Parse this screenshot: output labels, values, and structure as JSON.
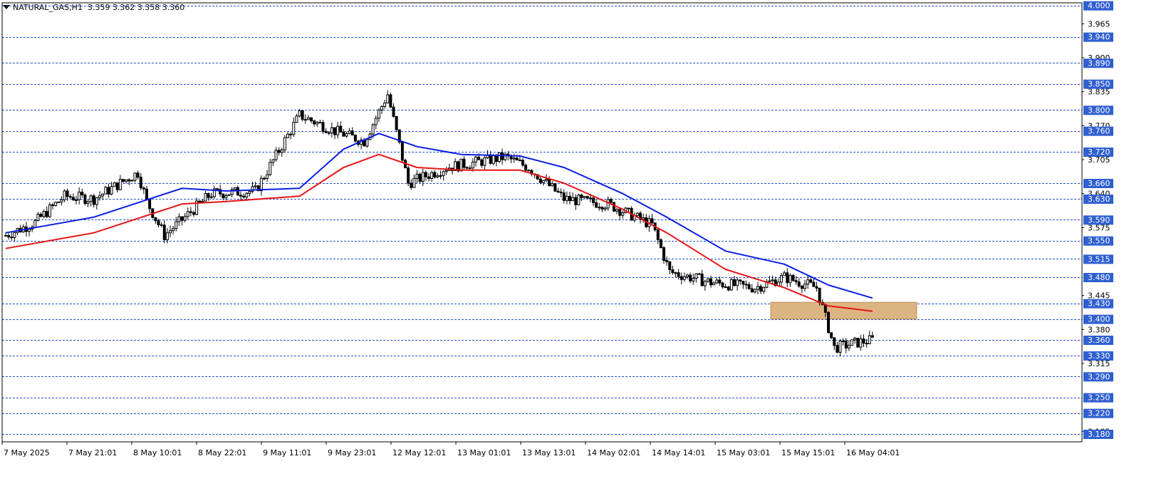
{
  "header": {
    "symbol": "NATURAL_GAS,H1",
    "ohlc": "3.359 3.362 3.358 3.360"
  },
  "colors": {
    "blue_line": "#0a1ee6",
    "red_line": "#e61414",
    "level_line": "#2850c8",
    "badge": "#2f5fd0",
    "zone": "#dcb482",
    "candle": "#000000"
  },
  "chart_data": {
    "type": "candlestick",
    "y_axis": {
      "min": 3.165,
      "max": 4.005,
      "ticks": [
        "3.965",
        "3.900",
        "3.835",
        "3.770",
        "3.705",
        "3.640",
        "3.575",
        "3.445",
        "3.380",
        "3.315",
        "3.185"
      ]
    },
    "levels": [
      "4.000",
      "3.940",
      "3.890",
      "3.850",
      "3.800",
      "3.760",
      "3.720",
      "3.660",
      "3.630",
      "3.590",
      "3.550",
      "3.515",
      "3.480",
      "3.430",
      "3.400",
      "3.360",
      "3.330",
      "3.290",
      "3.250",
      "3.220",
      "3.180"
    ],
    "zone": {
      "low": 3.4,
      "high": 3.432
    },
    "x_labels": [
      "7 May 2025",
      "7 May 21:01",
      "8 May 10:01",
      "8 May 22:01",
      "9 May 11:01",
      "9 May 23:01",
      "12 May 12:01",
      "13 May 01:01",
      "13 May 13:01",
      "14 May 02:01",
      "14 May 14:01",
      "15 May 03:01",
      "15 May 15:01",
      "16 May 04:01"
    ],
    "close_anchors": [
      [
        0,
        3.56
      ],
      [
        10,
        3.585
      ],
      [
        20,
        3.635
      ],
      [
        30,
        3.63
      ],
      [
        45,
        3.68
      ],
      [
        48,
        3.625
      ],
      [
        54,
        3.56
      ],
      [
        70,
        3.64
      ],
      [
        85,
        3.645
      ],
      [
        100,
        3.79
      ],
      [
        112,
        3.76
      ],
      [
        122,
        3.74
      ],
      [
        130,
        3.83
      ],
      [
        137,
        3.66
      ],
      [
        150,
        3.69
      ],
      [
        170,
        3.71
      ],
      [
        178,
        3.69
      ],
      [
        190,
        3.63
      ],
      [
        205,
        3.62
      ],
      [
        220,
        3.58
      ],
      [
        226,
        3.49
      ],
      [
        240,
        3.47
      ],
      [
        255,
        3.46
      ],
      [
        265,
        3.48
      ],
      [
        276,
        3.46
      ],
      [
        282,
        3.345
      ],
      [
        290,
        3.355
      ],
      [
        295,
        3.36
      ]
    ],
    "series": [
      {
        "name": "",
        "points": [
          [
            0,
            3.565
          ],
          [
            30,
            3.595
          ],
          [
            60,
            3.65
          ],
          [
            75,
            3.645
          ],
          [
            100,
            3.65
          ],
          [
            115,
            3.725
          ],
          [
            127,
            3.755
          ],
          [
            140,
            3.73
          ],
          [
            155,
            3.715
          ],
          [
            175,
            3.712
          ],
          [
            190,
            3.69
          ],
          [
            210,
            3.64
          ],
          [
            225,
            3.595
          ],
          [
            245,
            3.53
          ],
          [
            265,
            3.505
          ],
          [
            280,
            3.465
          ],
          [
            295,
            3.44
          ]
        ]
      },
      {
        "name": "",
        "points": [
          [
            0,
            3.535
          ],
          [
            30,
            3.565
          ],
          [
            60,
            3.62
          ],
          [
            75,
            3.625
          ],
          [
            100,
            3.635
          ],
          [
            115,
            3.69
          ],
          [
            127,
            3.715
          ],
          [
            140,
            3.69
          ],
          [
            155,
            3.685
          ],
          [
            175,
            3.685
          ],
          [
            190,
            3.66
          ],
          [
            210,
            3.61
          ],
          [
            225,
            3.565
          ],
          [
            245,
            3.495
          ],
          [
            265,
            3.46
          ],
          [
            280,
            3.425
          ],
          [
            295,
            3.415
          ]
        ]
      }
    ]
  }
}
